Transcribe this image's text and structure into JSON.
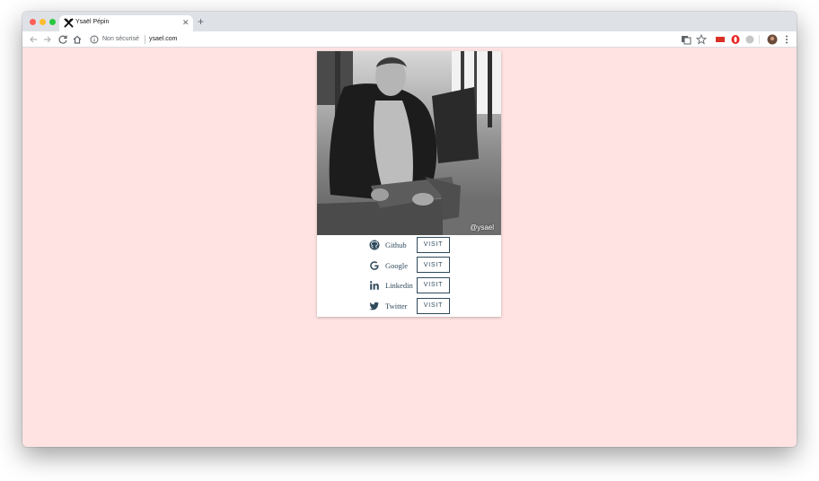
{
  "browser": {
    "tab_title": "Ysaël Pépin",
    "security_label": "Non sécurisé",
    "url": "ysael.com"
  },
  "profile": {
    "watermark": "@ysael",
    "links": [
      {
        "label": "Github",
        "button": "VISIT",
        "icon": "github-icon"
      },
      {
        "label": "Google",
        "button": "VISIT",
        "icon": "google-icon"
      },
      {
        "label": "Linkedin",
        "button": "VISIT",
        "icon": "linkedin-icon"
      },
      {
        "label": "Twitter",
        "button": "VISIT",
        "icon": "twitter-icon"
      }
    ]
  },
  "colors": {
    "page_background": "#ffe3e2",
    "accent": "#2f4a5c"
  }
}
